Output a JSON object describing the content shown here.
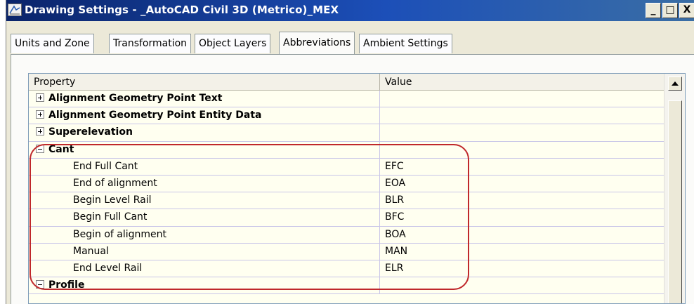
{
  "window": {
    "title": "Drawing Settings - _AutoCAD Civil 3D (Metrico)_MEX",
    "caption_buttons": {
      "minimize": "_",
      "maximize": "□",
      "close": "X"
    },
    "icon": "drawing-settings-icon"
  },
  "tabs": [
    {
      "label": "Units and Zone",
      "active": false
    },
    {
      "label": "Transformation",
      "active": false
    },
    {
      "label": "Object Layers",
      "active": false
    },
    {
      "label": "Abbreviations",
      "active": true
    },
    {
      "label": "Ambient Settings",
      "active": false
    }
  ],
  "grid": {
    "headers": {
      "property": "Property",
      "value": "Value"
    },
    "rows": [
      {
        "type": "category",
        "expander": "plus",
        "label": "Alignment Geometry Point Text",
        "value": ""
      },
      {
        "type": "category",
        "expander": "plus",
        "label": "Alignment Geometry Point Entity Data",
        "value": ""
      },
      {
        "type": "category",
        "expander": "plus",
        "label": "Superelevation",
        "value": ""
      },
      {
        "type": "category",
        "expander": "minus",
        "label": "Cant",
        "value": ""
      },
      {
        "type": "child",
        "label": "End Full Cant",
        "value": "EFC"
      },
      {
        "type": "child",
        "label": "End of alignment",
        "value": "EOA"
      },
      {
        "type": "child",
        "label": "Begin Level Rail",
        "value": "BLR"
      },
      {
        "type": "child",
        "label": "Begin Full Cant",
        "value": "BFC"
      },
      {
        "type": "child",
        "label": "Begin of alignment",
        "value": "BOA"
      },
      {
        "type": "child",
        "label": "Manual",
        "value": "MAN"
      },
      {
        "type": "child",
        "label": "End Level Rail",
        "value": "ELR"
      },
      {
        "type": "category",
        "expander": "minus",
        "label": "Profile",
        "value": ""
      }
    ]
  },
  "colors": {
    "titlebar": "#0a246a",
    "grid_background": "#fffff0",
    "highlight": "#c0282b"
  }
}
